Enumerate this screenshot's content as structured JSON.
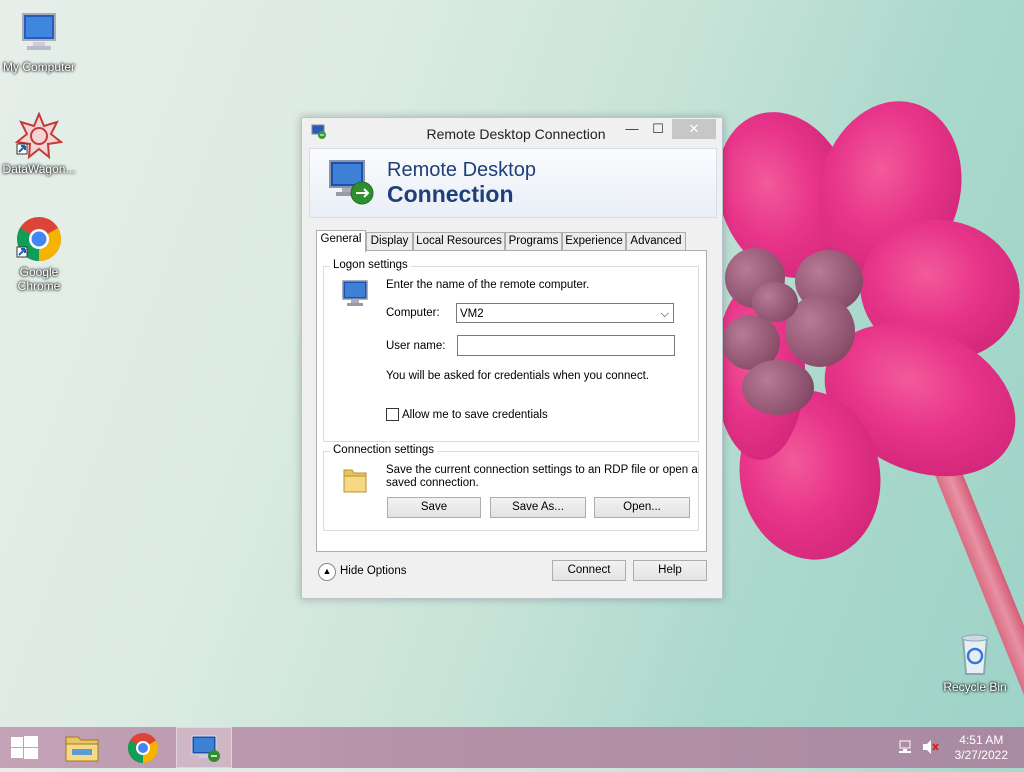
{
  "desktop": {
    "icons": [
      {
        "label": "My Computer"
      },
      {
        "label": "DataWagon..."
      },
      {
        "label": "Google Chrome"
      },
      {
        "label": "Recycle Bin"
      }
    ]
  },
  "window": {
    "title": "Remote Desktop Connection",
    "banner_line1": "Remote Desktop",
    "banner_line2": "Connection",
    "tabs": [
      "General",
      "Display",
      "Local Resources",
      "Programs",
      "Experience",
      "Advanced"
    ],
    "logon": {
      "title": "Logon settings",
      "instruction": "Enter the name of the remote computer.",
      "computer_label": "Computer:",
      "computer_value": "VM2",
      "username_label": "User name:",
      "username_value": "",
      "credentials_note": "You will be asked for credentials when you connect.",
      "allow_save_label": "Allow me to save credentials",
      "allow_save_checked": false
    },
    "connection": {
      "title": "Connection settings",
      "description_line1": "Save the current connection settings to an RDP file or open a",
      "description_line2": "saved connection.",
      "save_label": "Save",
      "save_as_label": "Save As...",
      "open_label": "Open..."
    },
    "footer": {
      "hide_options_label": "Hide Options",
      "connect_label": "Connect",
      "help_label": "Help"
    }
  },
  "taskbar": {
    "time": "4:51 AM",
    "date": "3/27/2022"
  }
}
